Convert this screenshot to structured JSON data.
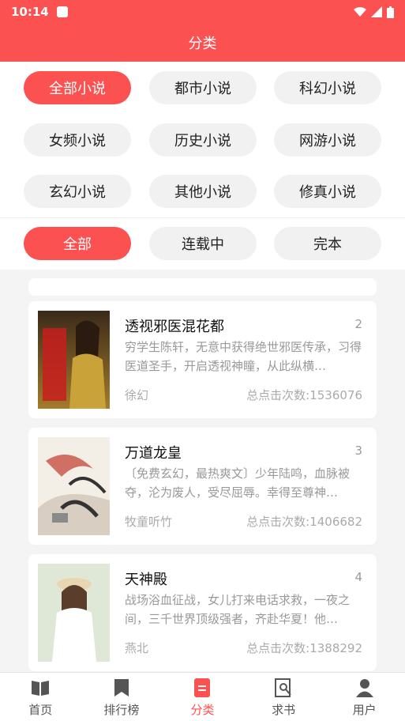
{
  "status": {
    "time": "10:14"
  },
  "header": {
    "title": "分类"
  },
  "categories": [
    "全部小说",
    "都市小说",
    "科幻小说",
    "女频小说",
    "历史小说",
    "网游小说",
    "玄幻小说",
    "其他小说",
    "修真小说"
  ],
  "status_filters": [
    "全部",
    "连载中",
    "完本"
  ],
  "books": [
    {
      "title": "透视邪医混花都",
      "rank": "2",
      "desc": "穷学生陈轩，无意中获得绝世邪医传承，习得医道圣手，开启透视神瞳，从此纵横…",
      "author": "徐幻",
      "clicks": "总点击次数:1536076"
    },
    {
      "title": "万道龙皇",
      "rank": "3",
      "desc": "〔免费玄幻，最热爽文〕少年陆鸣，血脉被夺，沦为废人，受尽屈辱。幸得至尊神…",
      "author": "牧童听竹",
      "clicks": "总点击次数:1406682"
    },
    {
      "title": "天神殿",
      "rank": "4",
      "desc": "战场浴血征战，女儿打来电话求救，一夜之间，三千世界顶级强者，齐赴华夏！他…",
      "author": "燕北",
      "clicks": "总点击次数:1388292"
    }
  ],
  "tabs": [
    {
      "label": "首页",
      "icon": "book-open-icon"
    },
    {
      "label": "排行榜",
      "icon": "bookmark-icon"
    },
    {
      "label": "分类",
      "icon": "category-icon",
      "active": true
    },
    {
      "label": "求书",
      "icon": "search-book-icon"
    },
    {
      "label": "用户",
      "icon": "user-icon"
    }
  ],
  "colors": {
    "accent": "#fb5151",
    "chip_bg": "#f1f1f1",
    "page_bg": "#f4f4f4"
  }
}
